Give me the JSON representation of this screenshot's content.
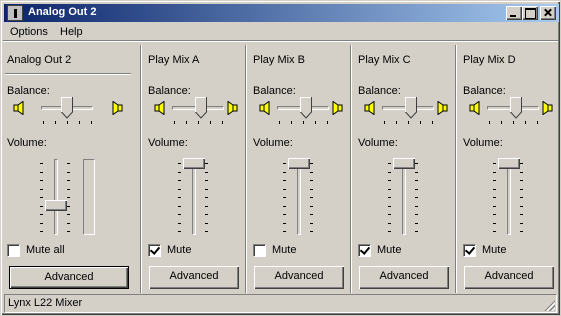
{
  "window": {
    "title": "Analog Out 2"
  },
  "menu": {
    "items": [
      "Options",
      "Help"
    ]
  },
  "master": {
    "title": "Analog Out 2",
    "balance_label": "Balance:",
    "volume_label": "Volume:",
    "balance": 0.5,
    "volume": 0.4,
    "mute_label": "Mute all",
    "mute_checked": false,
    "advanced_label": "Advanced"
  },
  "strips": [
    {
      "title": "Play Mix A",
      "balance_label": "Balance:",
      "volume_label": "Volume:",
      "balance": 0.55,
      "volume": 1.0,
      "mute_label": "Mute",
      "mute_checked": true,
      "advanced_label": "Advanced"
    },
    {
      "title": "Play Mix B",
      "balance_label": "Balance:",
      "volume_label": "Volume:",
      "balance": 0.55,
      "volume": 1.0,
      "mute_label": "Mute",
      "mute_checked": false,
      "advanced_label": "Advanced"
    },
    {
      "title": "Play Mix C",
      "balance_label": "Balance:",
      "volume_label": "Volume:",
      "balance": 0.55,
      "volume": 1.0,
      "mute_label": "Mute",
      "mute_checked": true,
      "advanced_label": "Advanced"
    },
    {
      "title": "Play Mix D",
      "balance_label": "Balance:",
      "volume_label": "Volume:",
      "balance": 0.55,
      "volume": 1.0,
      "mute_label": "Mute",
      "mute_checked": true,
      "advanced_label": "Advanced"
    }
  ],
  "status": {
    "text": "Lynx L22 Mixer"
  },
  "icons": {
    "app": "mixer-icon",
    "speaker_left": "speaker-left-icon",
    "speaker_right": "speaker-right-icon"
  },
  "colors": {
    "title_start": "#0a246a",
    "title_end": "#a6caf0",
    "face": "#d4d0c8",
    "speaker": "#ffff00"
  }
}
